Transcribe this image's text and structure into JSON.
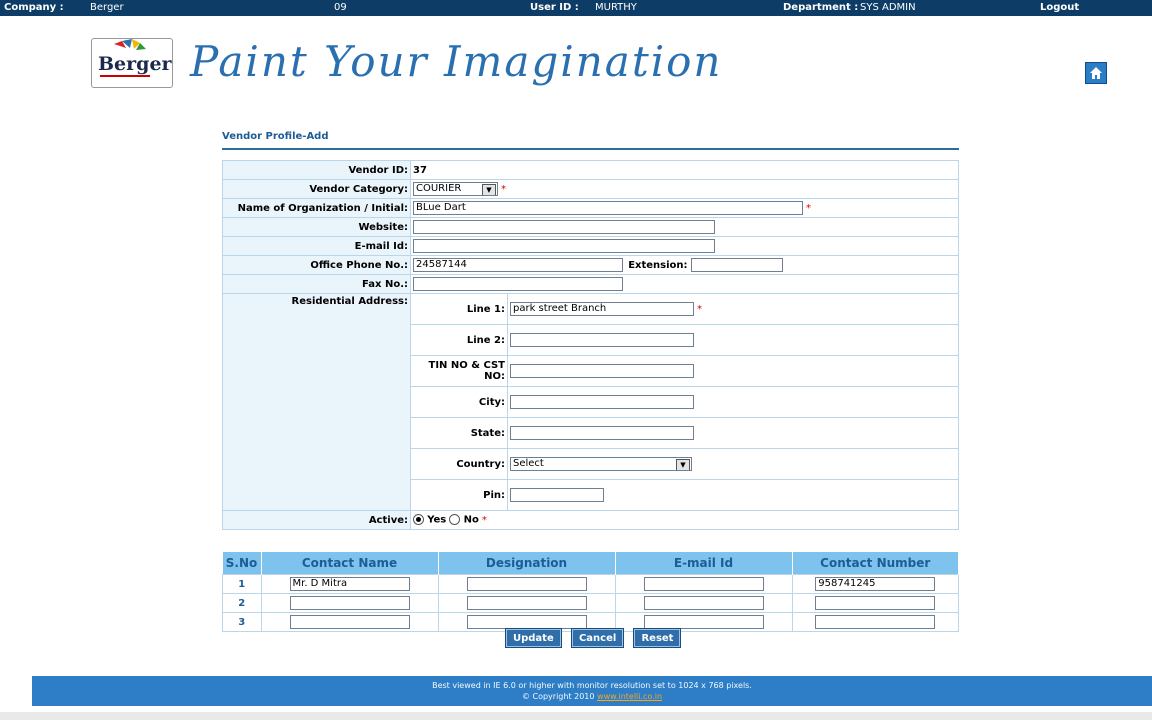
{
  "topbar": {
    "company_label": "Company :",
    "company_value": "Berger",
    "code": "09",
    "userid_label": "User ID :",
    "userid_value": "MURTHY",
    "dept_label": "Department :",
    "dept_value": "SYS ADMIN",
    "logout": "Logout"
  },
  "header": {
    "logo_text": "Berger",
    "tagline": "Paint Your Imagination"
  },
  "page_title": "Vendor Profile-Add",
  "form": {
    "vendor_id_label": "Vendor ID:",
    "vendor_id_value": "37",
    "category_label": "Vendor Category:",
    "category_value": "COURIER",
    "org_label": "Name of Organization / Initial:",
    "org_value": "BLue Dart",
    "website_label": "Website:",
    "website_value": "",
    "email_label": "E-mail Id:",
    "email_value": "",
    "phone_label": "Office Phone No.:",
    "phone_value": "24587144",
    "extension_label": "Extension:",
    "extension_value": "",
    "fax_label": "Fax No.:",
    "fax_value": "",
    "address_label": "Residential Address:",
    "address": {
      "line1_label": "Line 1:",
      "line1_value": "park street Branch",
      "line2_label": "Line 2:",
      "line2_value": "",
      "tin_label": "TIN NO & CST NO:",
      "tin_value": "",
      "city_label": "City:",
      "city_value": "",
      "state_label": "State:",
      "state_value": "",
      "country_label": "Country:",
      "country_value": "Select",
      "pin_label": "Pin:",
      "pin_value": ""
    },
    "active_label": "Active:",
    "active_yes": "Yes",
    "active_no": "No",
    "required_mark": "*"
  },
  "contacts": {
    "headers": [
      "S.No",
      "Contact Name",
      "Designation",
      "E-mail Id",
      "Contact Number"
    ],
    "rows": [
      {
        "sno": "1",
        "name": "Mr. D Mitra",
        "designation": "",
        "email": "",
        "number": "958741245"
      },
      {
        "sno": "2",
        "name": "",
        "designation": "",
        "email": "",
        "number": ""
      },
      {
        "sno": "3",
        "name": "",
        "designation": "",
        "email": "",
        "number": ""
      }
    ]
  },
  "buttons": {
    "update": "Update",
    "cancel": "Cancel",
    "reset": "Reset"
  },
  "footer": {
    "line1": "Best viewed in IE 6.0 or higher with monitor resolution set to 1024 x 768 pixels.",
    "copyright": "© Copyright 2010",
    "link": "www.intelli.co.in"
  },
  "colors": {
    "topbar": "#0d3c66",
    "accent": "#1e5c96",
    "table_header": "#7ec3ee",
    "footer": "#2d7ec6",
    "required": "#dd0000"
  }
}
